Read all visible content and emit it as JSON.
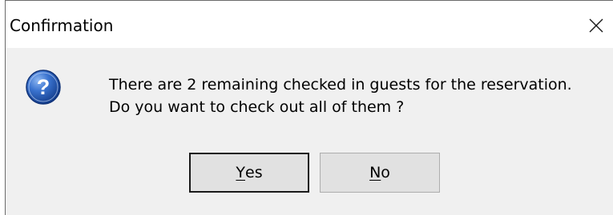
{
  "dialog": {
    "title": "Confirmation",
    "icon": "question-icon",
    "message_line1": "There are 2 remaining checked in guests for the reservation.",
    "message_line2": "Do you want to check out all of them ?",
    "buttons": {
      "yes": {
        "mnemonic": "Y",
        "rest": "es"
      },
      "no": {
        "mnemonic": "N",
        "rest": "o"
      }
    }
  }
}
